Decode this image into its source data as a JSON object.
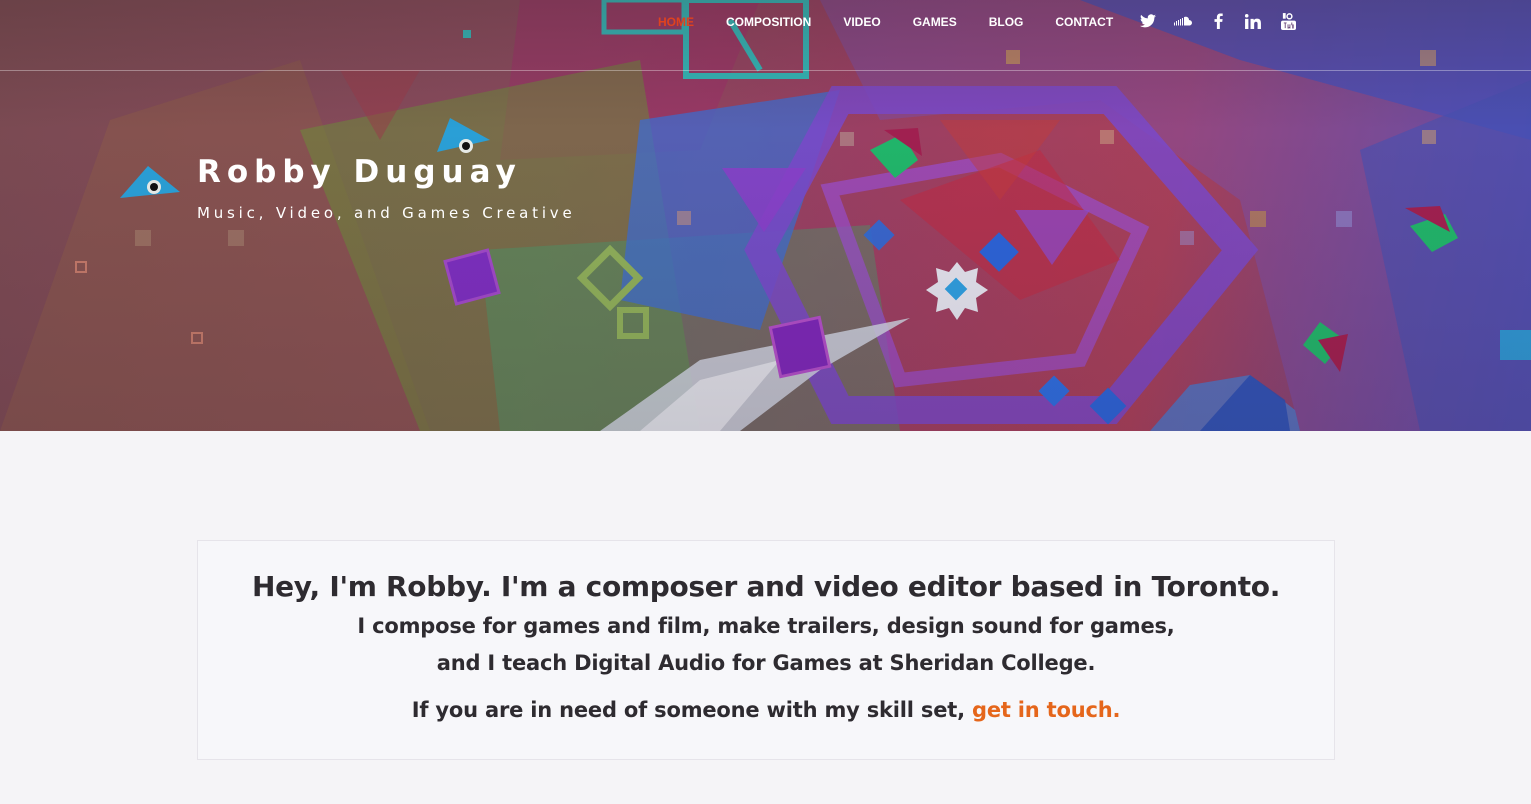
{
  "nav": {
    "items": [
      {
        "label": "HOME",
        "active": true
      },
      {
        "label": "COMPOSITION",
        "active": false
      },
      {
        "label": "VIDEO",
        "active": false
      },
      {
        "label": "GAMES",
        "active": false
      },
      {
        "label": "BLOG",
        "active": false
      },
      {
        "label": "CONTACT",
        "active": false
      }
    ],
    "social": [
      "twitter-icon",
      "soundcloud-icon",
      "facebook-icon",
      "linkedin-icon",
      "youtube-icon"
    ],
    "active_color": "#e0421e"
  },
  "hero": {
    "title": "Robby Duguay",
    "tagline": "Music, Video, and Games Creative"
  },
  "intro": {
    "heading": "Hey, I'm Robby. I'm a composer and video editor based in Toronto.",
    "line1": "I compose for games and film, make trailers, design sound for games,",
    "line2": "and I teach Digital Audio for Games at Sheridan College.",
    "cta_text": "If you are in need of someone with my skill set, ",
    "cta_link": "get in touch.",
    "link_color": "#e5661b"
  }
}
